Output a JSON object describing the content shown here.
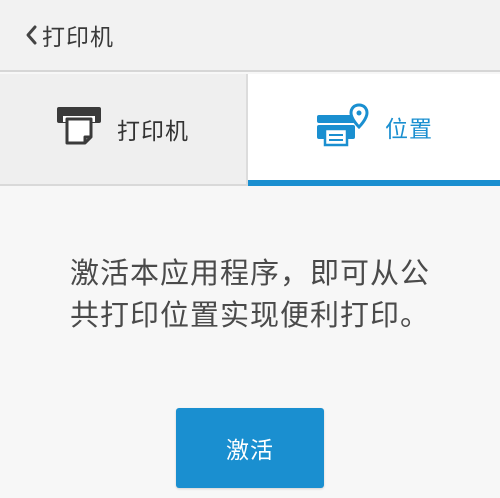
{
  "header": {
    "back_icon": "chevron-left-icon",
    "title": "打印机"
  },
  "tabs": [
    {
      "label": "打印机",
      "icon": "printer-icon",
      "selected": false
    },
    {
      "label": "位置",
      "icon": "printer-location-icon",
      "selected": true
    }
  ],
  "main": {
    "message": "激活本应用程序，即可从公共打印位置实现便利打印。",
    "activate_label": "激活"
  },
  "colors": {
    "accent": "#1a8fd0",
    "header_bg": "#f2f2f2",
    "content_bg": "#f7f7f7",
    "text_dark": "#333333"
  }
}
